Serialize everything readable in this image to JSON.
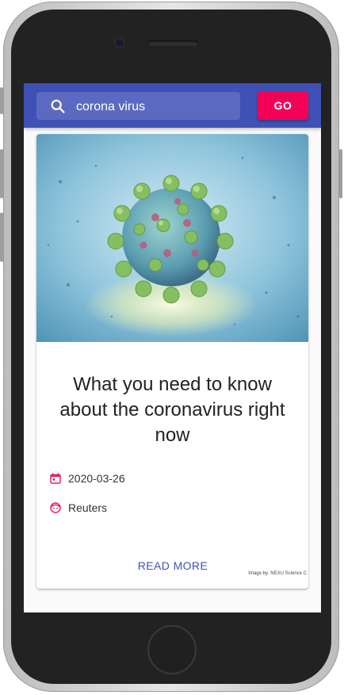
{
  "colors": {
    "primary": "#3f51b5",
    "accent": "#f50057",
    "meta_icon": "#e91e63"
  },
  "appbar": {
    "search_value": "corona virus",
    "search_icon": "search-icon",
    "go_label": "GO"
  },
  "card": {
    "image_alt_icon": "coronavirus-illustration",
    "image_credit": "Image by: NEXU Science C",
    "title": "What you need to know about the coronavirus right now",
    "date": "2020-03-26",
    "date_icon": "calendar-icon",
    "source": "Reuters",
    "source_icon": "face-icon",
    "read_more_label": "READ MORE"
  }
}
